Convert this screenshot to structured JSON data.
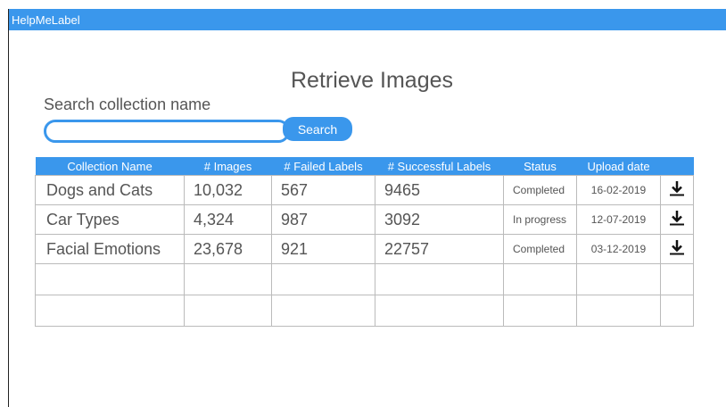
{
  "app": {
    "title": "HelpMeLabel"
  },
  "page": {
    "title": "Retrieve Images"
  },
  "search": {
    "label": "Search collection name",
    "value": "",
    "placeholder": "",
    "button_label": "Search"
  },
  "table": {
    "headers": [
      "Collection Name",
      "# Images",
      "# Failed Labels",
      "# Successful Labels",
      "Status",
      "Upload date",
      ""
    ],
    "rows": [
      {
        "name": "Dogs and Cats",
        "images": "10,032",
        "failed": "567",
        "successful": "9465",
        "status": "Completed",
        "date": "16-02-2019",
        "icon": "download-icon"
      },
      {
        "name": "Car Types",
        "images": "4,324",
        "failed": "987",
        "successful": "3092",
        "status": "In progress",
        "date": "12-07-2019",
        "icon": "download-icon"
      },
      {
        "name": "Facial Emotions",
        "images": "23,678",
        "failed": "921",
        "successful": "22757",
        "status": "Completed",
        "date": "03-12-2019",
        "icon": "download-icon"
      }
    ],
    "empty_rows": 2
  },
  "colors": {
    "accent": "#3a97ec",
    "text": "#555555",
    "border": "#bbbbbb"
  }
}
